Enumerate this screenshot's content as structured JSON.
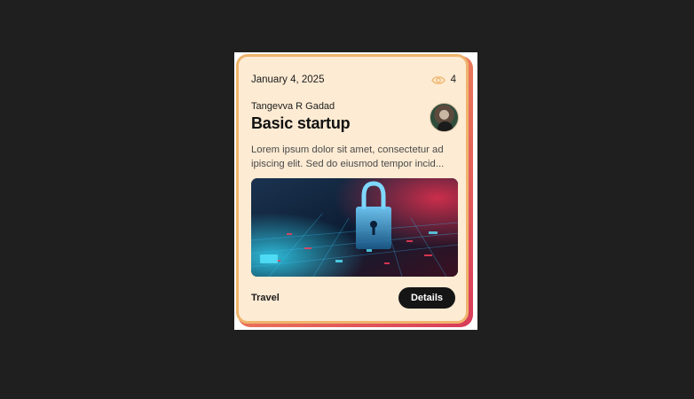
{
  "card": {
    "date": "January 4, 2025",
    "views": "4",
    "author": "Tangevva R Gadad",
    "title": "Basic startup",
    "description_line1": "Lorem ipsum dolor sit amet, consectetur ad",
    "description_line2": "ipiscing elit. Sed do eiusmod tempor incid...",
    "image_subject": "cyber-security-padlock-on-circuit-board",
    "category": "Travel",
    "details_label": "Details",
    "eye_icon": "eye-icon",
    "accent_color": "#efb46c",
    "card_background": "#fdebd3",
    "button_color": "#151515"
  }
}
